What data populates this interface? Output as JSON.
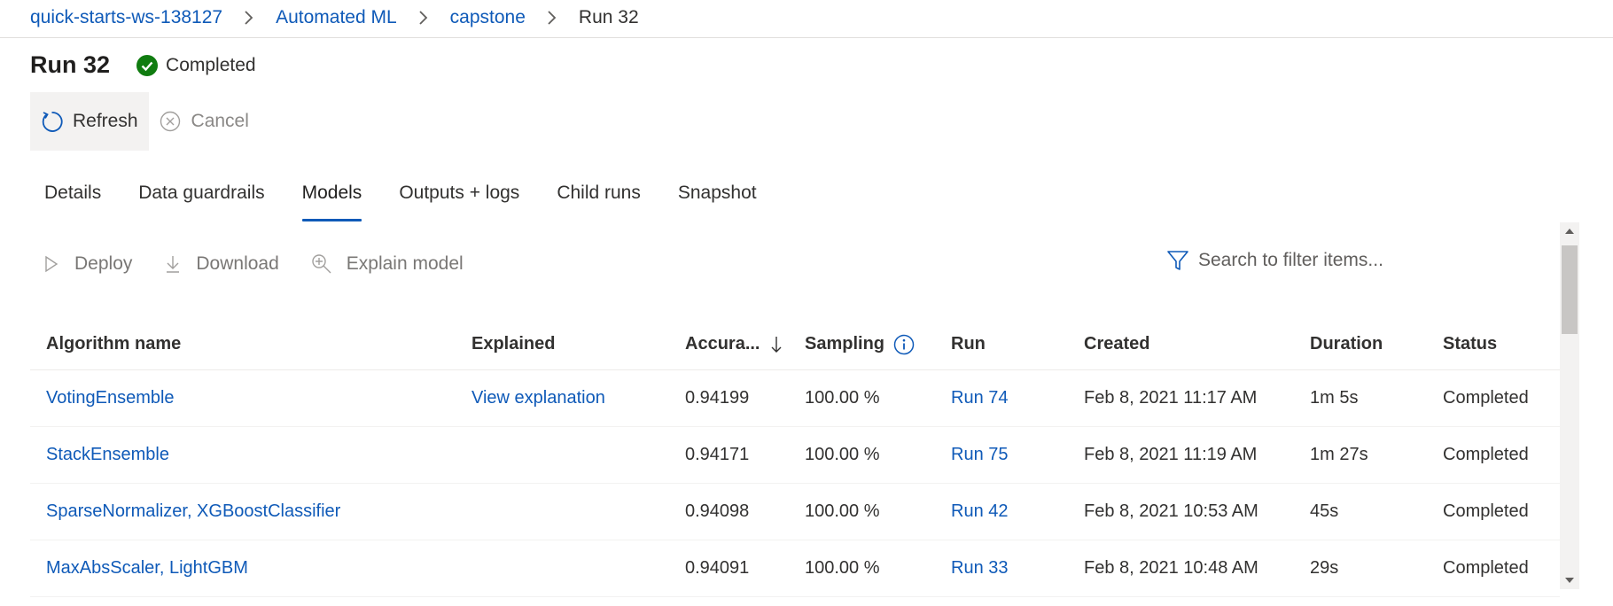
{
  "breadcrumb": {
    "items": [
      "quick-starts-ws-138127",
      "Automated ML",
      "capstone"
    ],
    "current": "Run 32"
  },
  "header": {
    "title": "Run 32",
    "status": "Completed",
    "status_color": "#107c10"
  },
  "commands": {
    "refresh": "Refresh",
    "cancel": "Cancel"
  },
  "tabs": [
    {
      "label": "Details",
      "active": false
    },
    {
      "label": "Data guardrails",
      "active": false
    },
    {
      "label": "Models",
      "active": true
    },
    {
      "label": "Outputs + logs",
      "active": false
    },
    {
      "label": "Child runs",
      "active": false
    },
    {
      "label": "Snapshot",
      "active": false
    }
  ],
  "toolbar": {
    "deploy": "Deploy",
    "download": "Download",
    "explain": "Explain model"
  },
  "search": {
    "placeholder": "Search to filter items..."
  },
  "table": {
    "columns": [
      "Algorithm name",
      "Explained",
      "Accura...",
      "Sampling",
      "Run",
      "Created",
      "Duration",
      "Status"
    ],
    "sort_column": "Accura...",
    "sort_direction": "descending",
    "rows": [
      {
        "algorithm": "VotingEnsemble",
        "explained": "View explanation",
        "accuracy": "0.94199",
        "sampling": "100.00 %",
        "run": "Run 74",
        "created": "Feb 8, 2021 11:17 AM",
        "duration": "1m 5s",
        "status": "Completed"
      },
      {
        "algorithm": "StackEnsemble",
        "explained": "",
        "accuracy": "0.94171",
        "sampling": "100.00 %",
        "run": "Run 75",
        "created": "Feb 8, 2021 11:19 AM",
        "duration": "1m 27s",
        "status": "Completed"
      },
      {
        "algorithm": "SparseNormalizer, XGBoostClassifier",
        "explained": "",
        "accuracy": "0.94098",
        "sampling": "100.00 %",
        "run": "Run 42",
        "created": "Feb 8, 2021 10:53 AM",
        "duration": "45s",
        "status": "Completed"
      },
      {
        "algorithm": "MaxAbsScaler, LightGBM",
        "explained": "",
        "accuracy": "0.94091",
        "sampling": "100.00 %",
        "run": "Run 33",
        "created": "Feb 8, 2021 10:48 AM",
        "duration": "29s",
        "status": "Completed"
      }
    ]
  },
  "colors": {
    "accent": "#0f5ab8",
    "success": "#107c10"
  }
}
